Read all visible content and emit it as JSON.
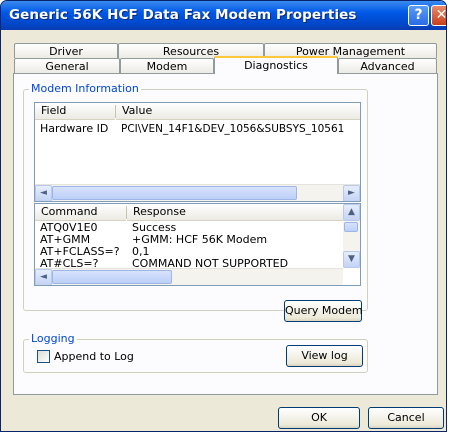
{
  "window": {
    "title": "Generic 56K HCF Data Fax Modem Properties",
    "help_glyph": "?",
    "close_glyph": "✕"
  },
  "tabs": {
    "top_row": [
      "Driver",
      "Resources",
      "Power Management"
    ],
    "bottom_row": [
      "General",
      "Modem",
      "Diagnostics",
      "Advanced"
    ],
    "active": "Diagnostics"
  },
  "modem_info": {
    "group_label": "Modem Information",
    "columns": [
      "Field",
      "Value"
    ],
    "rows": [
      {
        "field": "Hardware ID",
        "value": "PCI\\VEN_14F1&DEV_1056&SUBSYS_10561"
      }
    ]
  },
  "responses": {
    "columns": [
      "Command",
      "Response"
    ],
    "rows": [
      {
        "command": "ATQ0V1E0",
        "response": "Success"
      },
      {
        "command": "AT+GMM",
        "response": "+GMM: HCF 56K Modem"
      },
      {
        "command": "AT+FCLASS=?",
        "response": "0,1"
      },
      {
        "command": "AT#CLS=?",
        "response": "COMMAND NOT SUPPORTED"
      }
    ]
  },
  "buttons": {
    "query_modem": "Query Modem",
    "view_log": "View log",
    "ok": "OK",
    "cancel": "Cancel"
  },
  "logging": {
    "group_label": "Logging",
    "append_label": "Append to Log",
    "append_checked": false
  },
  "icons": {
    "scroll_left": "◄",
    "scroll_right": "►",
    "scroll_up": "▲",
    "scroll_down": "▼"
  },
  "colors": {
    "titlebar": "#0058e6",
    "group_label": "#0046d5",
    "active_tab_accent": "#ffc83c"
  }
}
